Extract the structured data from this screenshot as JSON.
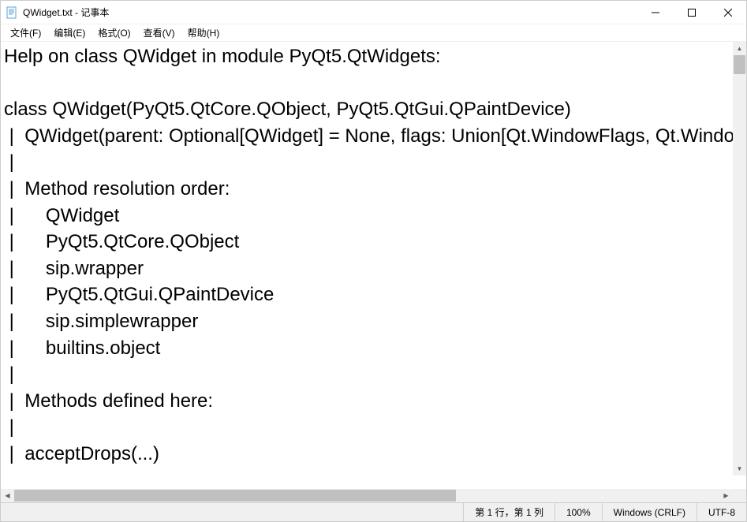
{
  "titlebar": {
    "title": "QWidget.txt - 记事本"
  },
  "menu": {
    "file": "文件(F)",
    "edit": "编辑(E)",
    "format": "格式(O)",
    "view": "查看(V)",
    "help": "帮助(H)"
  },
  "document": {
    "text": "Help on class QWidget in module PyQt5.QtWidgets:\n\nclass QWidget(PyQt5.QtCore.QObject, PyQt5.QtGui.QPaintDevice)\n |  QWidget(parent: Optional[QWidget] = None, flags: Union[Qt.WindowFlags, Qt.WindowType] = Qt.WindowFlags())\n |  \n |  Method resolution order:\n |      QWidget\n |      PyQt5.QtCore.QObject\n |      sip.wrapper\n |      PyQt5.QtGui.QPaintDevice\n |      sip.simplewrapper\n |      builtins.object\n |  \n |  Methods defined here:\n |  \n |  acceptDrops(...)"
  },
  "statusbar": {
    "position": "第 1 行，第 1 列",
    "zoom": "100%",
    "line_ending": "Windows (CRLF)",
    "encoding": "UTF-8"
  }
}
